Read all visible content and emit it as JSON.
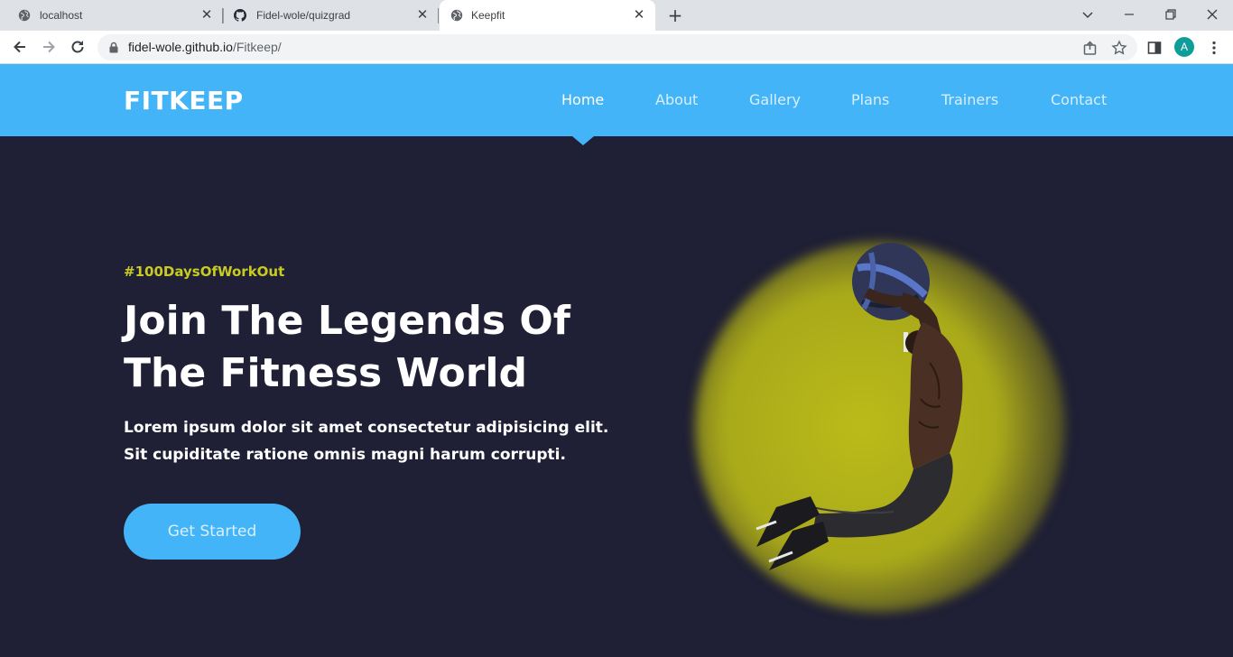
{
  "browser": {
    "tabs": [
      {
        "title": "localhost",
        "icon": "globe-icon",
        "active": false
      },
      {
        "title": "Fidel-wole/quizgrad",
        "icon": "github-icon",
        "active": false
      },
      {
        "title": "Keepfit",
        "icon": "globe-icon",
        "active": true
      }
    ],
    "url_host": "fidel-wole.github.io",
    "url_path": "/Fitkeep/",
    "profile_initial": "A",
    "accent": "#0f9d9a"
  },
  "site": {
    "logo": "FITKEEP",
    "nav": [
      {
        "label": "Home",
        "active": true
      },
      {
        "label": "About",
        "active": false
      },
      {
        "label": "Gallery",
        "active": false
      },
      {
        "label": "Plans",
        "active": false
      },
      {
        "label": "Trainers",
        "active": false
      },
      {
        "label": "Contact",
        "active": false
      }
    ],
    "header_color": "#42b4f7",
    "background_color": "#1f1f35"
  },
  "hero": {
    "tag": "#100DaysOfWorkOut",
    "title_line1": "Join The Legends Of",
    "title_line2": "The Fitness World",
    "text_line1": "Lorem ipsum dolor sit amet consectetur adipisicing elit.",
    "text_line2": "Sit cupiditate ratione omnis magni harum corrupti.",
    "cta_label": "Get Started",
    "tag_color": "#c9cb22",
    "image": "athlete-with-medicine-ball"
  }
}
